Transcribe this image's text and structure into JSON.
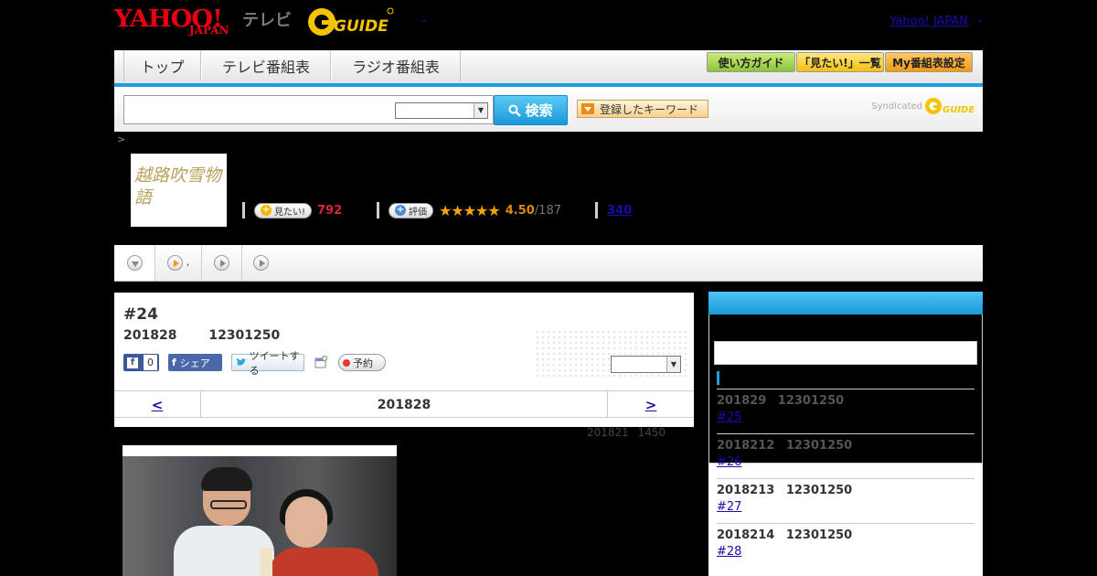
{
  "header": {
    "logo_yahoo": "YAHOO!",
    "logo_japan": "JAPAN",
    "logo_tv": "テレビ",
    "logo_gguide": "GUIDE",
    "top_link": "Yahoo! JAPAN"
  },
  "nav": {
    "tabs": [
      {
        "label": "トップ"
      },
      {
        "label": "テレビ番組表"
      },
      {
        "label": "ラジオ番組表"
      }
    ],
    "buttons": [
      {
        "label": "使い方ガイド"
      },
      {
        "label": "「見たい!」一覧"
      },
      {
        "label": "My番組表設定"
      }
    ]
  },
  "search": {
    "button_label": "検索",
    "keyword_button": "登録したキーワード",
    "syndicated": "Syndicated"
  },
  "breadcrumb": ">",
  "program": {
    "thumb_text": "越路吹雪物語",
    "mitai_label": "見たい!",
    "mitai_count": "792",
    "hyoka_label": "評価",
    "stars": "★★★★★",
    "rating": "4.50",
    "rating_count": "/187",
    "review_count": "340"
  },
  "subtabs": [
    {
      "label": ""
    },
    {
      "label": ","
    },
    {
      "label": ""
    },
    {
      "label": ""
    }
  ],
  "episode": {
    "title": "#24",
    "date": "201828 12301250",
    "like_count": "0",
    "share_label": "シェア",
    "tweet_label": "ツイートする",
    "reserve_label": "予約",
    "pager_prev": "<",
    "pager_center": "201828",
    "pager_next": ">",
    "broadcast_note": "201821 1450"
  },
  "sidebar": {
    "items": [
      {
        "date": "201829 12301250",
        "ep": "#25"
      },
      {
        "date": "2018212 12301250",
        "ep": "#26"
      },
      {
        "date": "2018213 12301250",
        "ep": "#27"
      },
      {
        "date": "2018214 12301250",
        "ep": "#28"
      }
    ]
  },
  "colors": {
    "accent_blue": "#1aa0e0",
    "brand_red": "#e60012",
    "star": "#f3a500",
    "mitai_red": "#d9223d"
  }
}
